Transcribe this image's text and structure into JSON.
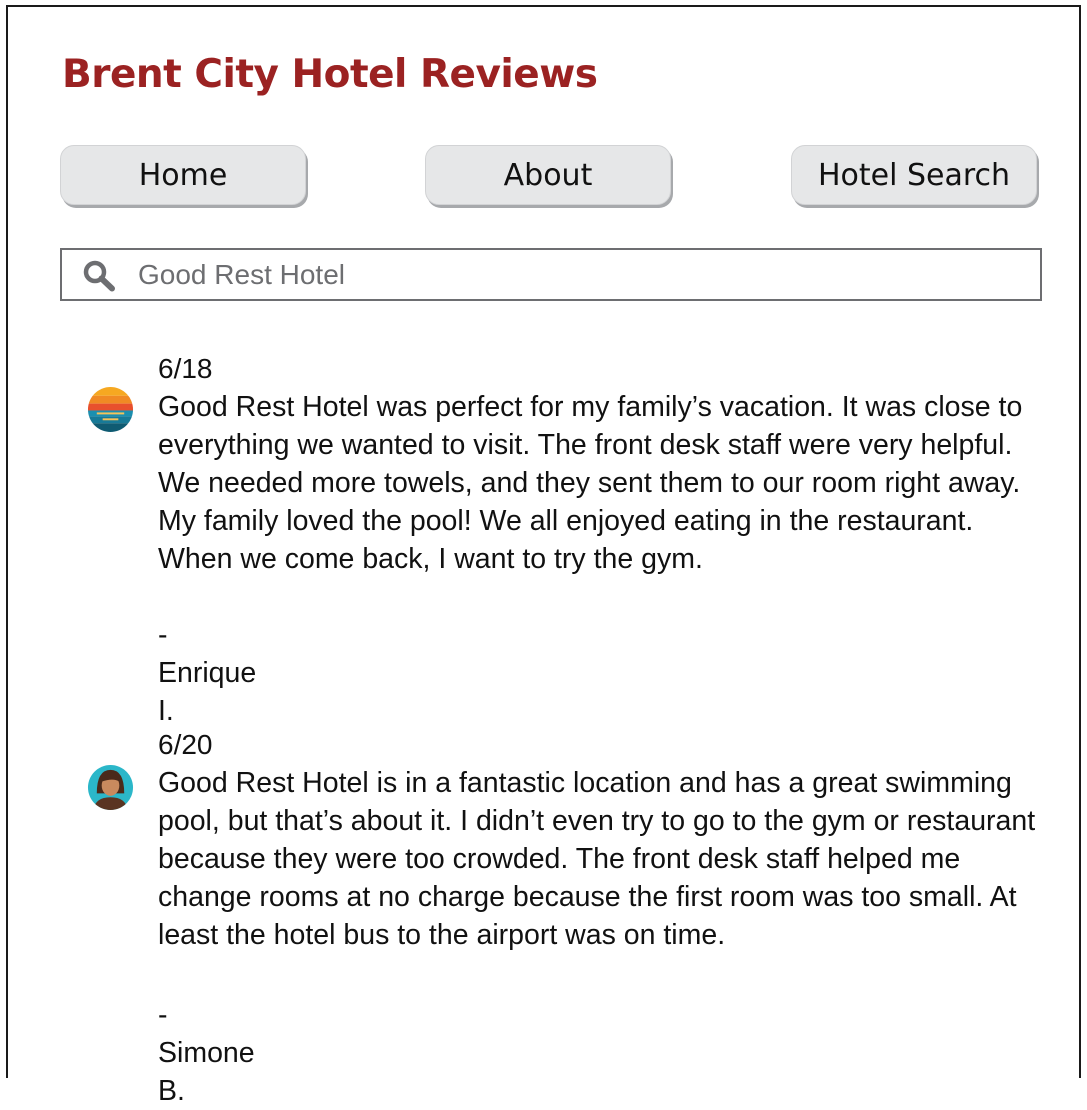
{
  "site": {
    "title": "Brent City Hotel Reviews"
  },
  "nav": {
    "home": "Home",
    "about": "About",
    "hotel_search": "Hotel Search"
  },
  "search": {
    "value": "Good Rest Hotel"
  },
  "reviews": [
    {
      "date": "6/18",
      "text": "Good Rest Hotel was perfect for my family’s vacation. It was close to everything we wanted to visit. The front desk staff were very helpful. We needed more towels, and they sent them to our room right away. My family loved the pool! We all enjoyed eating in the restaurant. When we come back, I want to try the gym.",
      "author": "- Enrique I.",
      "avatar_icon": "sunset-avatar-icon"
    },
    {
      "date": "6/20",
      "text": "Good Rest Hotel is in a fantastic location and has a great swimming pool, but that’s about it. I didn’t even try to go to the gym or restaurant because they were too crowded. The front desk staff helped me change rooms at no charge because the first room was too small. At least the hotel bus to the airport was on time.",
      "author": "- Simone B.",
      "avatar_icon": "woman-avatar-icon"
    }
  ],
  "colors": {
    "title": "#9b2222",
    "button_bg": "#e6e7e8",
    "button_shadow": "#a7a9ac",
    "search_border": "#6d6e71",
    "search_text": "#6d6e71"
  }
}
